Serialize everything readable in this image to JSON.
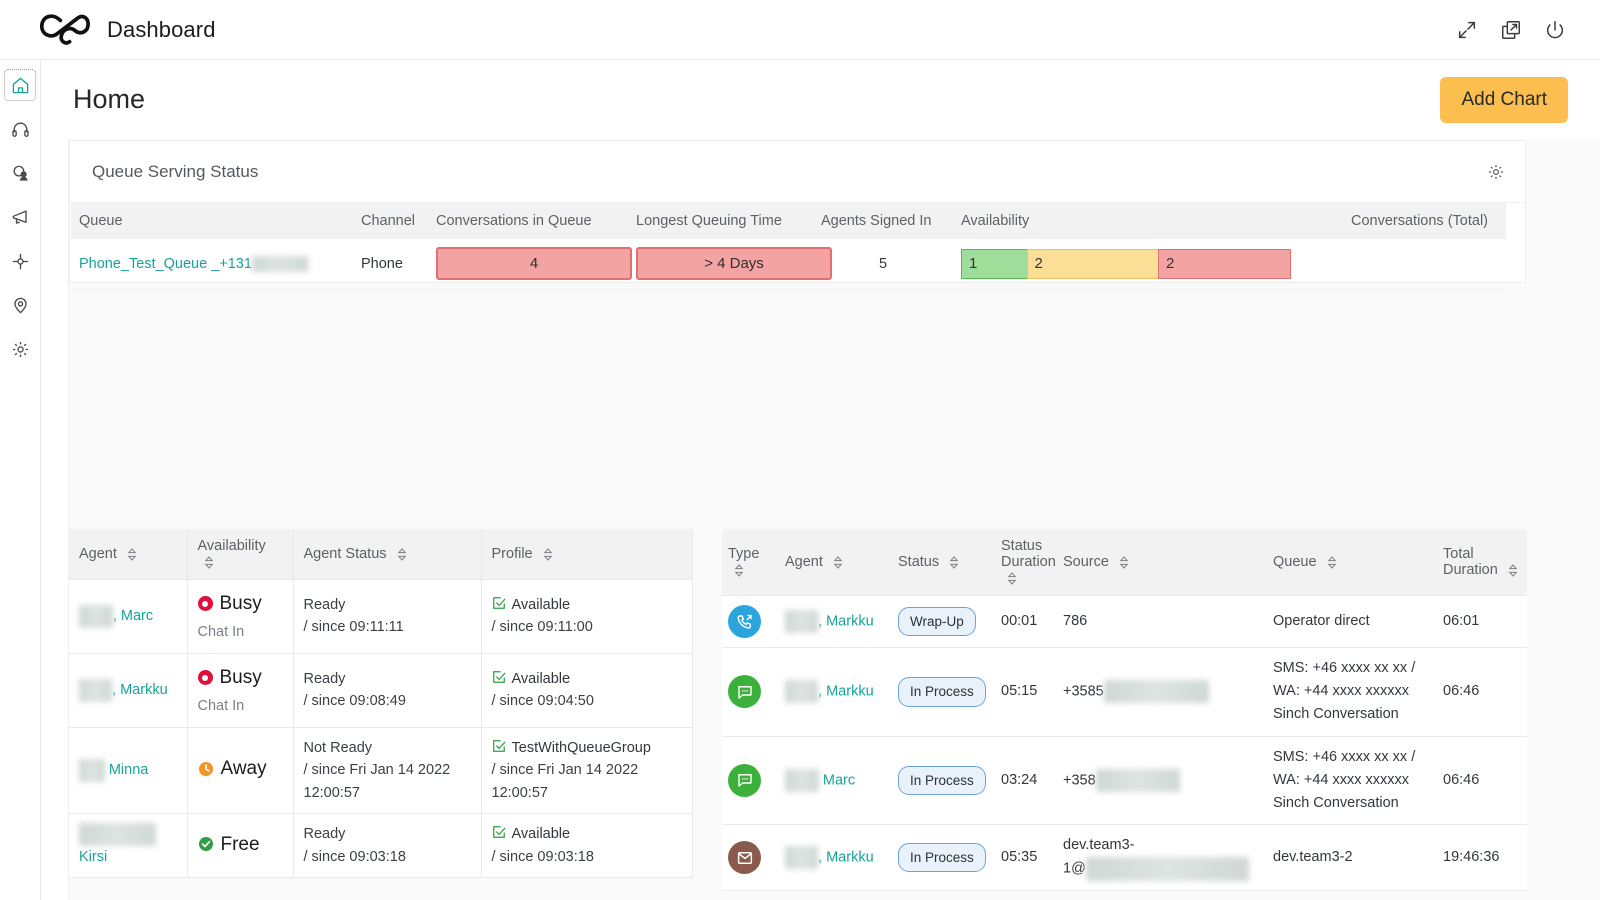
{
  "app": {
    "brand_title": "Dashboard",
    "logo_icon": "sinch-infinity-logo",
    "topbar_icons": [
      {
        "name": "expand-fullscreen-icon",
        "label": "Expand"
      },
      {
        "name": "open-in-new-window-icon",
        "label": "Open in new window"
      },
      {
        "name": "power-logout-icon",
        "label": "Log out"
      }
    ]
  },
  "sidebar": {
    "items": [
      {
        "name": "home",
        "icon": "home-icon",
        "active": true
      },
      {
        "name": "headset",
        "icon": "headset-icon",
        "active": false
      },
      {
        "name": "contacts",
        "icon": "contacts-icon",
        "active": false
      },
      {
        "name": "campaigns",
        "icon": "megaphone-icon",
        "active": false
      },
      {
        "name": "flows",
        "icon": "flow-icon",
        "active": false
      },
      {
        "name": "locations",
        "icon": "location-pin-icon",
        "active": false
      },
      {
        "name": "settings",
        "icon": "gear-icon",
        "active": false
      }
    ]
  },
  "page": {
    "title": "Home",
    "add_chart_label": "Add Chart"
  },
  "queue_card": {
    "title": "Queue Serving Status",
    "settings_icon": "gear-icon",
    "columns": [
      "Queue",
      "Channel",
      "Conversations in Queue",
      "Longest Queuing Time",
      "Agents Signed In",
      "Availability",
      "Conversations (Total)"
    ],
    "row": {
      "queue_name": "Phone_Test_Queue _+131",
      "queue_name_redacted": "9147365",
      "channel": "Phone",
      "conversations_in_queue": "4",
      "longest_queuing_time": "> 4 Days",
      "agents_signed_in": "5",
      "availability": [
        {
          "value": "1",
          "color": "#9ede9a",
          "border": "#5db95d",
          "state": "free"
        },
        {
          "value": "2",
          "color": "#fcdf96",
          "border": "#edc25d",
          "state": "away"
        },
        {
          "value": "2",
          "color": "#f4a3a3",
          "border": "#e07070",
          "state": "busy"
        }
      ],
      "conversations_total": ""
    }
  },
  "agents_table": {
    "columns": [
      {
        "label": "Agent",
        "sortable": true
      },
      {
        "label": "Availability",
        "sortable": true
      },
      {
        "label": "Agent Status",
        "sortable": true
      },
      {
        "label": "Profile",
        "sortable": true
      }
    ],
    "rows": [
      {
        "agent_redacted": "Cirus",
        "agent_name": ", Marc",
        "availability": "Busy",
        "availability_icon": "busy-dot-icon",
        "availability_sub": "Chat In",
        "status": "Ready",
        "status_since": "/ since 09:11:11",
        "profile_icon": "checkbox-check-icon",
        "profile": "Available",
        "profile_since": "/ since 09:11:00"
      },
      {
        "agent_redacted": "Halin",
        "agent_name": ", Markku",
        "availability": "Busy",
        "availability_icon": "busy-dot-icon",
        "availability_sub": "Chat In",
        "status": "Ready",
        "status_since": "/ since 09:08:49",
        "profile_icon": "checkbox-check-icon",
        "profile": "Available",
        "profile_since": "/ since 09:04:50"
      },
      {
        "agent_redacted": "Tesi",
        "agent_name": " Minna",
        "availability": "Away",
        "availability_icon": "away-clock-icon",
        "availability_sub": "",
        "status": "Not Ready",
        "status_since": "/ since Fri Jan 14 2022 12:00:57",
        "profile_icon": "checkbox-check-icon",
        "profile": "TestWithQueueGroup",
        "profile_since": "/ since Fri Jan 14 2022 12:00:57"
      },
      {
        "agent_redacted": "Vaalenhorn,",
        "agent_name": "Kirsi",
        "availability": "Free",
        "availability_icon": "free-check-icon",
        "availability_sub": "",
        "status": "Ready",
        "status_since": "/ since 09:03:18",
        "profile_icon": "checkbox-check-icon",
        "profile": "Available",
        "profile_since": "/ since 09:03:18"
      }
    ]
  },
  "conversations_table": {
    "columns": [
      {
        "label": "Type",
        "sortable": true
      },
      {
        "label": "Agent",
        "sortable": true
      },
      {
        "label": "Status",
        "sortable": true
      },
      {
        "label": "Status Duration",
        "sortable": true
      },
      {
        "label": "Source",
        "sortable": true
      },
      {
        "label": "Queue",
        "sortable": true
      },
      {
        "label": "Total Duration",
        "sortable": true
      }
    ],
    "rows": [
      {
        "type_icon": "outgoing-call-icon",
        "type_color": "#2ba5dc",
        "agent_redacted": "Halin",
        "agent_name": ", Markku",
        "status": "Wrap-Up",
        "status_duration": "00:01",
        "source": "786",
        "source_redacted": "",
        "queue_lines": [
          "Operator direct"
        ],
        "total_duration": "06:01"
      },
      {
        "type_icon": "chat-bubble-icon",
        "type_color": "#3bb13b",
        "agent_redacted": "Halin",
        "agent_name": ", Markku",
        "status": "In Process",
        "status_duration": "05:15",
        "source": "+3585",
        "source_redacted": "0412345678900",
        "queue_lines": [
          "SMS: +46 xxxx xx xx /",
          "WA: +44 xxxx xxxxxx",
          "Sinch Conversation"
        ],
        "total_duration": "06:46"
      },
      {
        "type_icon": "chat-bubble-icon",
        "type_color": "#3bb13b",
        "agent_redacted": "Cirus",
        "agent_name": " Marc",
        "status": "In Process",
        "status_duration": "03:24",
        "source": "+358",
        "source_redacted": "04123 Marku",
        "queue_lines": [
          "SMS: +46 xxxx xx xx /",
          "WA: +44 xxxx xxxxxx",
          "Sinch Conversation"
        ],
        "total_duration": "06:46"
      },
      {
        "type_icon": "email-icon",
        "type_color": "#8b5a4e",
        "agent_redacted": "Halin",
        "agent_name": ", Markku",
        "status": "In Process",
        "status_duration": "05:35",
        "source": "dev.team3-",
        "source_line2": "1@",
        "source_redacted": "sinch-hes.messages.com",
        "queue_lines": [
          "dev.team3-2"
        ],
        "total_duration": "19:46:36"
      }
    ]
  },
  "colors": {
    "accent_teal": "#17a398",
    "accent_amber": "#fbbe4f",
    "busy_red": "#e0103c",
    "away_orange": "#f59324",
    "free_green": "#2f9e44",
    "badge_blue": "#6ba4dd",
    "header_grey": "#f2f2f2"
  }
}
